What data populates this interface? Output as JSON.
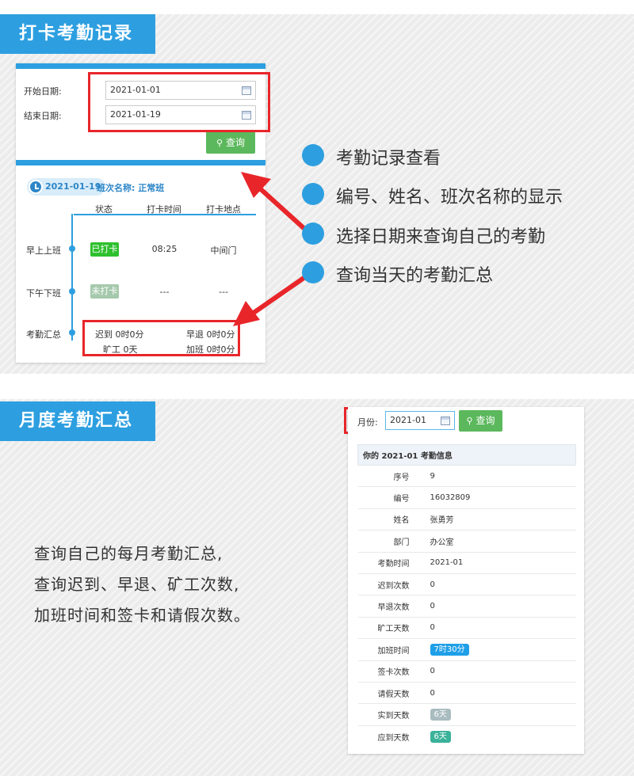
{
  "section1": {
    "title": "打卡考勤记录",
    "start_label": "开始日期:",
    "start_value": "2021-01-01",
    "end_label": "结束日期:",
    "end_value": "2021-01-19",
    "query_label": "查询",
    "record": {
      "date": "2021-01-19",
      "shift": "班次名称: 正常班",
      "columns": [
        "状态",
        "打卡时间",
        "打卡地点"
      ],
      "rows": [
        {
          "label": "早上上班",
          "status": "已打卡",
          "time": "08:25",
          "place": "中间门"
        },
        {
          "label": "下午下班",
          "status": "未打卡",
          "time": "---",
          "place": "---"
        }
      ],
      "summary_label": "考勤汇总",
      "summary": {
        "late": "迟到 0时0分",
        "early": "早退 0时0分",
        "absent": "旷工 0天",
        "overtime": "加班 0时0分"
      }
    }
  },
  "bullets": [
    "考勤记录查看",
    "编号、姓名、班次名称的显示",
    "选择日期来查询自己的考勤",
    "查询当天的考勤汇总"
  ],
  "section2": {
    "title": "月度考勤汇总",
    "description": [
      "查询自己的每月考勤汇总,",
      "查询迟到、早退、矿工次数,",
      "加班时间和签卡和请假次数。"
    ],
    "month_label": "月份:",
    "month_value": "2021-01",
    "query_label": "查询",
    "table_title": "你的 2021-01 考勤信息",
    "rows": [
      {
        "k": "序号",
        "v": "9"
      },
      {
        "k": "编号",
        "v": "16032809"
      },
      {
        "k": "姓名",
        "v": "张勇芳"
      },
      {
        "k": "部门",
        "v": "办公室"
      },
      {
        "k": "考勤时间",
        "v": "2021-01"
      },
      {
        "k": "迟到次数",
        "v": "0"
      },
      {
        "k": "早退次数",
        "v": "0"
      },
      {
        "k": "旷工天数",
        "v": "0"
      },
      {
        "k": "加班时间",
        "v": "7时30分",
        "badge": "#1e9fe8"
      },
      {
        "k": "签卡次数",
        "v": "0"
      },
      {
        "k": "请假天数",
        "v": "0"
      },
      {
        "k": "实到天数",
        "v": "6天",
        "badge": "#a9bcc0"
      },
      {
        "k": "应到天数",
        "v": "6天",
        "badge": "#3bb29a"
      }
    ]
  },
  "colors": {
    "accent": "#2d9fe0",
    "success": "#5cb85c",
    "highlight": "#e8262a",
    "badge_done": "#2ec02e",
    "badge_pending": "#a5c9ac"
  }
}
